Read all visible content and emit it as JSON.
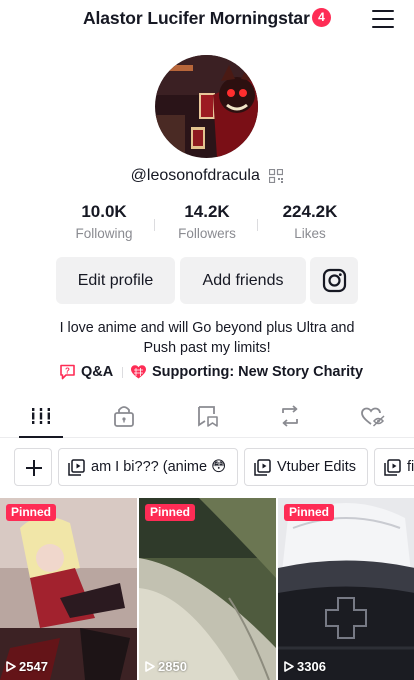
{
  "header": {
    "title": "Alastor Lucifer Morningstar",
    "notification_count": "4"
  },
  "profile": {
    "username": "@leosonofdracula",
    "stats": [
      {
        "value": "10.0K",
        "label": "Following"
      },
      {
        "value": "14.2K",
        "label": "Followers"
      },
      {
        "value": "224.2K",
        "label": "Likes"
      }
    ],
    "buttons": {
      "edit_profile": "Edit profile",
      "add_friends": "Add friends"
    },
    "bio_line1": "I love anime and will Go beyond plus Ultra and",
    "bio_line2": "Push past my limits!",
    "links": {
      "qa": "Q&A",
      "charity": "Supporting: New Story Charity"
    }
  },
  "tabs": [
    {
      "name": "videos",
      "icon": "grid-icon",
      "active": true
    },
    {
      "name": "private",
      "icon": "lock-icon"
    },
    {
      "name": "favorites",
      "icon": "bookmark-icon"
    },
    {
      "name": "reposts",
      "icon": "repost-icon"
    },
    {
      "name": "liked",
      "icon": "hidden-heart-icon"
    }
  ],
  "playlists": [
    {
      "label": "am I bi??? (anime 😳"
    },
    {
      "label": "Vtuber Edits"
    },
    {
      "label": "fi"
    }
  ],
  "videos": [
    {
      "pinned_label": "Pinned",
      "views": "2547"
    },
    {
      "pinned_label": "Pinned",
      "views": "2850"
    },
    {
      "pinned_label": "Pinned",
      "views": "3306"
    }
  ],
  "colors": {
    "accent": "#fe2c55",
    "button_bg": "#f1f1f2",
    "muted_text": "#8a8b91"
  }
}
